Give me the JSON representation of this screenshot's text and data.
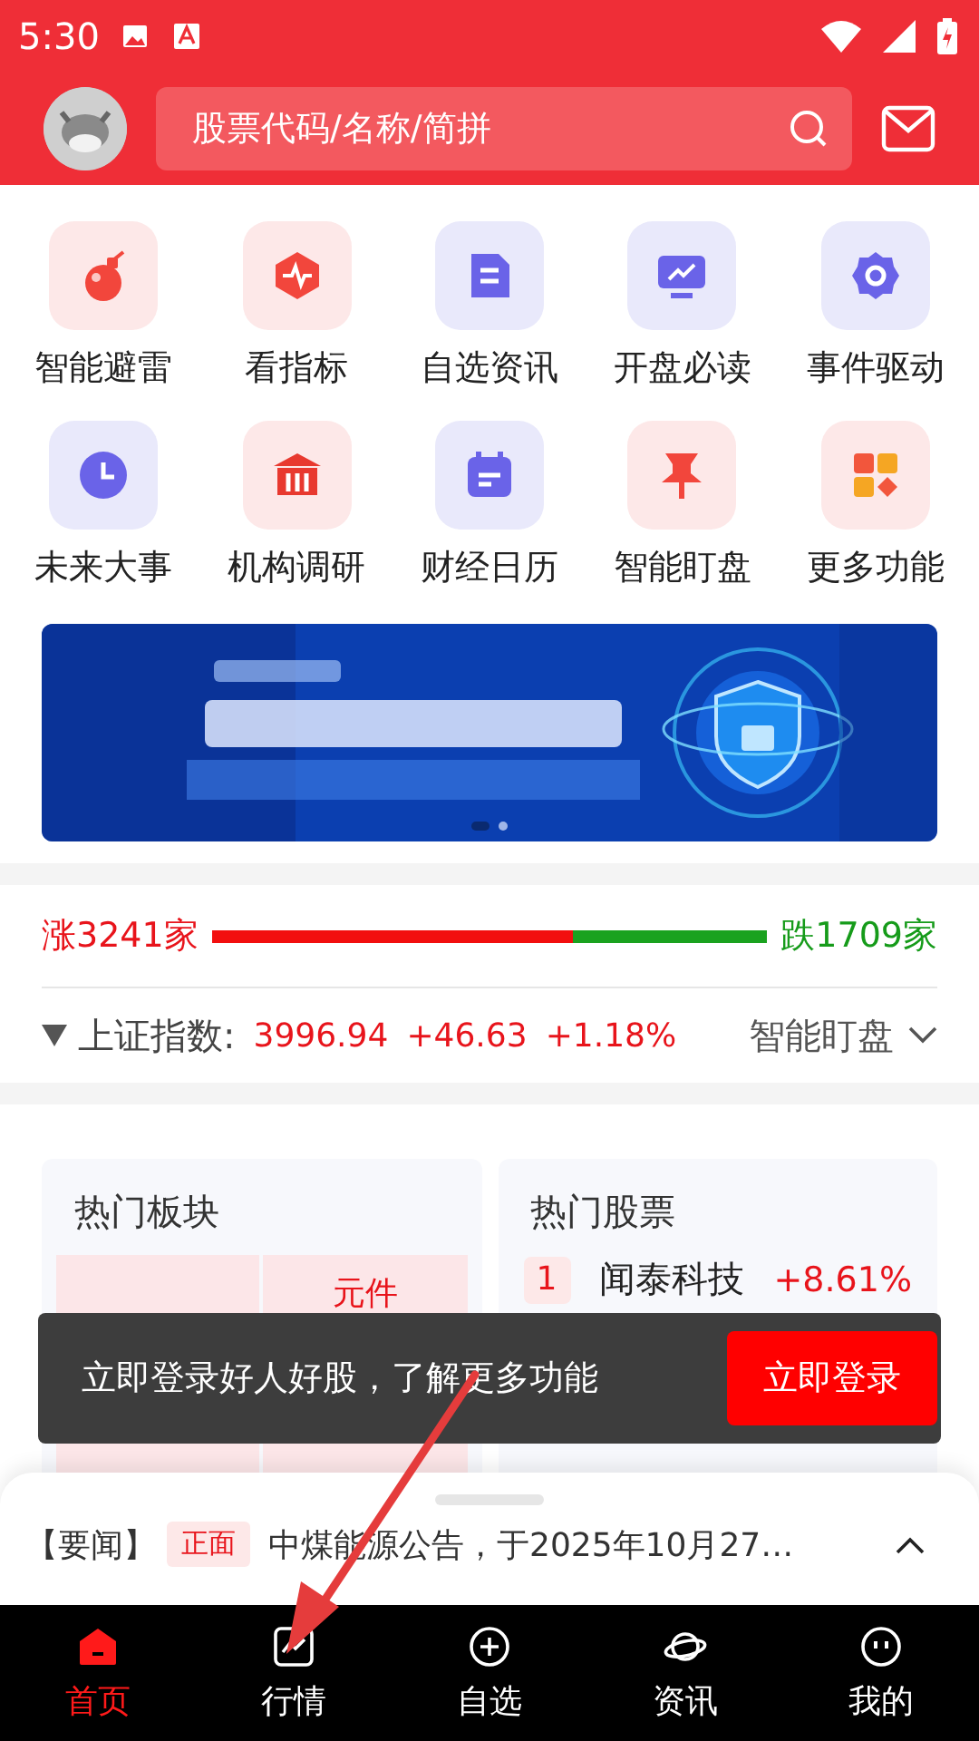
{
  "status_bar": {
    "time": "5:30"
  },
  "header": {
    "search": {
      "placeholder": "股票代码/名称/简拼"
    }
  },
  "features": [
    {
      "label": "智能避雷",
      "kind": "bomb"
    },
    {
      "label": "看指标",
      "kind": "pulse"
    },
    {
      "label": "自选资讯",
      "kind": "doc"
    },
    {
      "label": "开盘必读",
      "kind": "monitor"
    },
    {
      "label": "事件驱动",
      "kind": "gear"
    },
    {
      "label": "未来大事",
      "kind": "clock"
    },
    {
      "label": "机构调研",
      "kind": "bank"
    },
    {
      "label": "财经日历",
      "kind": "calendar"
    },
    {
      "label": "智能盯盘",
      "kind": "pin"
    },
    {
      "label": "更多功能",
      "kind": "grid"
    }
  ],
  "banner": {
    "kind": "picture",
    "pager": [
      {
        "selected": true
      },
      {
        "selected": false
      }
    ]
  },
  "breadth": {
    "up": "涨3241家",
    "down": "跌1709家",
    "level": 0.65
  },
  "index": {
    "name": "上证指数:",
    "value": "3996.94",
    "change": "+46.63",
    "percent": "+1.18%",
    "action": "智能盯盘"
  },
  "sectors": {
    "title": "热门板块",
    "items": [
      {
        "name": "元件"
      }
    ]
  },
  "stocks": {
    "title": "热门股票",
    "items": [
      {
        "rank": "1",
        "name": "闻泰科技",
        "change": "+8.61%"
      }
    ]
  },
  "toast": {
    "message": "立即登录好人好股，了解更多功能",
    "button": "立即登录"
  },
  "news": {
    "source": "【要闻】",
    "tag": "正面",
    "headline": "中煤能源公告，于2025年10月27…"
  },
  "nav": [
    {
      "label": "首页",
      "kind": "home",
      "selected": true
    },
    {
      "label": "行情",
      "kind": "chart",
      "selected": false
    },
    {
      "label": "自选",
      "kind": "plus",
      "selected": false
    },
    {
      "label": "资讯",
      "kind": "planet",
      "selected": false
    },
    {
      "label": "我的",
      "kind": "face",
      "selected": false
    }
  ]
}
